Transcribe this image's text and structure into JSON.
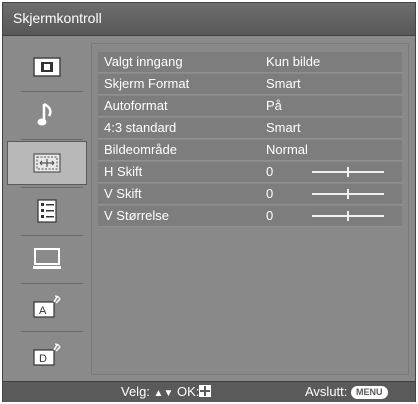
{
  "title": "Skjermkontroll",
  "sidebar": {
    "items": [
      {
        "icon": "picture-icon"
      },
      {
        "icon": "sound-icon"
      },
      {
        "icon": "screen-control-icon",
        "active": true
      },
      {
        "icon": "setup-icon"
      },
      {
        "icon": "pc-icon"
      },
      {
        "icon": "analog-tuning-icon",
        "glyph": "A"
      },
      {
        "icon": "digital-tuning-icon",
        "glyph": "D"
      }
    ]
  },
  "settings": [
    {
      "label": "Valgt inngang",
      "value": "Kun bilde"
    },
    {
      "label": "Skjerm Format",
      "value": "Smart"
    },
    {
      "label": "Autoformat",
      "value": "På"
    },
    {
      "label": "4:3 standard",
      "value": "Smart"
    },
    {
      "label": "Bildeområde",
      "value": "Normal"
    },
    {
      "label": "H Skift",
      "value": "0",
      "slider": 0.5
    },
    {
      "label": "V Skift",
      "value": "0",
      "slider": 0.5
    },
    {
      "label": "V Størrelse",
      "value": "0",
      "slider": 0.5
    }
  ],
  "footer": {
    "hint_prefix": "Velg:",
    "hint_arrows": "▲▼",
    "hint_ok": "OK:",
    "exit_label": "Avslutt:",
    "menu_label": "MENU"
  }
}
